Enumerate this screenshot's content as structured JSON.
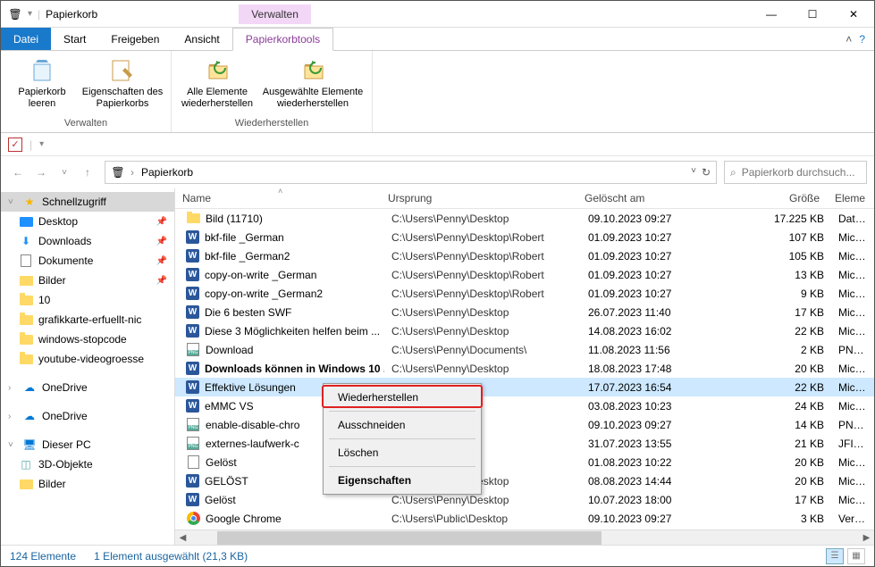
{
  "window": {
    "title": "Papierkorb",
    "contextual_caption": "Verwalten"
  },
  "win_controls": {
    "minimize": "—",
    "maximize": "☐",
    "close": "✕"
  },
  "tabs": {
    "file": "Datei",
    "items": [
      "Start",
      "Freigeben",
      "Ansicht"
    ],
    "contextual": "Papierkorbtools",
    "collapse_caret": "˄",
    "help": "?"
  },
  "ribbon": {
    "groups": [
      {
        "caption": "Verwalten",
        "buttons": [
          {
            "name": "empty-bin",
            "label": "Papierkorb leeren"
          },
          {
            "name": "bin-props",
            "label": "Eigenschaften des Papierkorbs"
          }
        ]
      },
      {
        "caption": "Wiederherstellen",
        "buttons": [
          {
            "name": "restore-all",
            "label": "Alle Elemente wiederherstellen"
          },
          {
            "name": "restore-sel",
            "label": "Ausgewählte Elemente wiederherstellen"
          }
        ]
      }
    ]
  },
  "quickbar": {
    "check": "✓",
    "divider": "|"
  },
  "nav": {
    "back": "←",
    "forward": "→",
    "recent_caret": "˅",
    "up": "↑",
    "crumb_root_icon": "🗑",
    "crumb_root": "",
    "crumb_current": "Papierkorb",
    "crumb_caret": "›",
    "fav": "✓",
    "refresh": "↻",
    "search_icon": "⌕",
    "search_placeholder": "Papierkorb durchsuch..."
  },
  "tree": {
    "quick": {
      "label": "Schnellzugriff",
      "exp": "˅",
      "items": [
        {
          "name": "desktop",
          "label": "Desktop",
          "pin": true,
          "icon": "desktop"
        },
        {
          "name": "downloads",
          "label": "Downloads",
          "pin": true,
          "icon": "dl"
        },
        {
          "name": "documents",
          "label": "Dokumente",
          "pin": true,
          "icon": "doc"
        },
        {
          "name": "pictures",
          "label": "Bilder",
          "pin": true,
          "icon": "pic"
        },
        {
          "name": "ten",
          "label": "10",
          "pin": false,
          "icon": "folder"
        },
        {
          "name": "gfx",
          "label": "grafikkarte-erfuellt-nic",
          "pin": false,
          "icon": "folder"
        },
        {
          "name": "stopcode",
          "label": "windows-stopcode",
          "pin": false,
          "icon": "folder"
        },
        {
          "name": "yt",
          "label": "youtube-videogroesse",
          "pin": false,
          "icon": "folder"
        }
      ]
    },
    "onedrive1": {
      "label": "OneDrive",
      "exp": "›"
    },
    "onedrive2": {
      "label": "OneDrive",
      "exp": "›"
    },
    "pc": {
      "label": "Dieser PC",
      "exp": "˅",
      "items": [
        {
          "name": "3d",
          "label": "3D-Objekte",
          "icon": "3d"
        },
        {
          "name": "pictures2",
          "label": "Bilder",
          "icon": "pic"
        }
      ]
    }
  },
  "columns": {
    "name": "Name",
    "origin": "Ursprung",
    "deleted": "Gelöscht am",
    "size": "Größe",
    "type": "Eleme",
    "sort_caret": "˄"
  },
  "rows": [
    {
      "icon": "folder",
      "name": "Bild (11710)",
      "origin": "C:\\Users\\Penny\\Desktop",
      "deleted": "09.10.2023 09:27",
      "size": "17.225 KB",
      "type": "Dateio"
    },
    {
      "icon": "word",
      "name": "bkf-file _German",
      "origin": "C:\\Users\\Penny\\Desktop\\Robert",
      "deleted": "01.09.2023 10:27",
      "size": "107 KB",
      "type": "Micros"
    },
    {
      "icon": "word",
      "name": "bkf-file _German2",
      "origin": "C:\\Users\\Penny\\Desktop\\Robert",
      "deleted": "01.09.2023 10:27",
      "size": "105 KB",
      "type": "Micros"
    },
    {
      "icon": "word",
      "name": "copy-on-write _German",
      "origin": "C:\\Users\\Penny\\Desktop\\Robert",
      "deleted": "01.09.2023 10:27",
      "size": "13 KB",
      "type": "Micros"
    },
    {
      "icon": "word",
      "name": "copy-on-write _German2",
      "origin": "C:\\Users\\Penny\\Desktop\\Robert",
      "deleted": "01.09.2023 10:27",
      "size": "9 KB",
      "type": "Micros"
    },
    {
      "icon": "word",
      "name": "Die 6 besten SWF",
      "origin": "C:\\Users\\Penny\\Desktop",
      "deleted": "26.07.2023 11:40",
      "size": "17 KB",
      "type": "Micros"
    },
    {
      "icon": "word",
      "name": "Diese 3 Möglichkeiten helfen beim ...",
      "origin": "C:\\Users\\Penny\\Desktop",
      "deleted": "14.08.2023 16:02",
      "size": "22 KB",
      "type": "Micros"
    },
    {
      "icon": "png",
      "name": "Download",
      "origin": "C:\\Users\\Penny\\Documents\\",
      "deleted": "11.08.2023 11:56",
      "size": "2 KB",
      "type": "PNG-D"
    },
    {
      "icon": "word",
      "name": "Downloads können in Windows 10 ...",
      "origin": "C:\\Users\\Penny\\Desktop",
      "deleted": "18.08.2023 17:48",
      "size": "20 KB",
      "type": "Micros",
      "bold": true
    },
    {
      "icon": "word",
      "name": "Effektive Lösungen",
      "origin": "esktop",
      "deleted": "17.07.2023 16:54",
      "size": "22 KB",
      "type": "Micros",
      "selected": true
    },
    {
      "icon": "word",
      "name": "eMMC VS",
      "origin": "esktop",
      "deleted": "03.08.2023 10:23",
      "size": "24 KB",
      "type": "Micros"
    },
    {
      "icon": "png",
      "name": "enable-disable-chro",
      "origin": "esktop",
      "deleted": "09.10.2023 09:27",
      "size": "14 KB",
      "type": "PNG-D"
    },
    {
      "icon": "png",
      "name": "externes-laufwerk-c",
      "origin": "ocuments\\",
      "deleted": "31.07.2023 13:55",
      "size": "21 KB",
      "type": "JFIF-D"
    },
    {
      "icon": "txt",
      "name": "Gelöst",
      "origin": "esktop",
      "deleted": "01.08.2023 10:22",
      "size": "20 KB",
      "type": "Micros"
    },
    {
      "icon": "word",
      "name": "GELÖST",
      "origin": "C:\\Users\\Penny\\Desktop",
      "deleted": "08.08.2023 14:44",
      "size": "20 KB",
      "type": "Micros"
    },
    {
      "icon": "word",
      "name": "Gelöst",
      "origin": "C:\\Users\\Penny\\Desktop",
      "deleted": "10.07.2023 18:00",
      "size": "17 KB",
      "type": "Micros"
    },
    {
      "icon": "chrome",
      "name": "Google Chrome",
      "origin": "C:\\Users\\Public\\Desktop",
      "deleted": "09.10.2023 09:27",
      "size": "3 KB",
      "type": "Verknü"
    }
  ],
  "context_menu": {
    "restore": "Wiederherstellen",
    "cut": "Ausschneiden",
    "delete": "Löschen",
    "properties": "Eigenschaften"
  },
  "status": {
    "count": "124 Elemente",
    "selection": "1 Element ausgewählt (21,3 KB)"
  }
}
